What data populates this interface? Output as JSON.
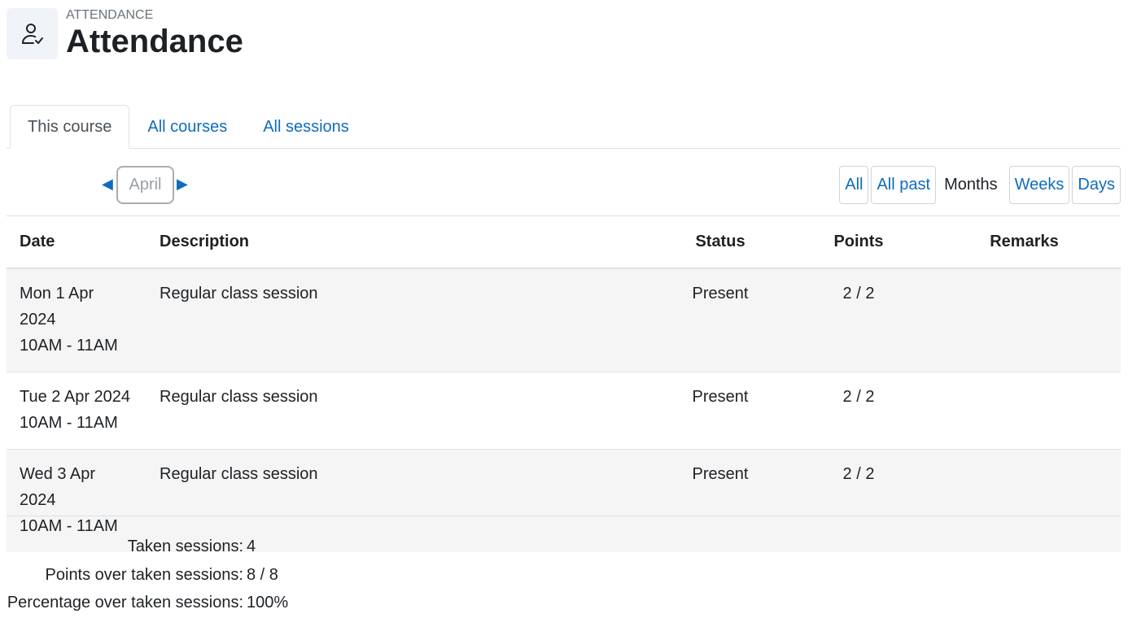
{
  "header": {
    "pretitle": "ATTENDANCE",
    "title": "Attendance",
    "icon": "user-check-icon"
  },
  "tabs": [
    {
      "label": "This course",
      "active": true
    },
    {
      "label": "All courses",
      "active": false
    },
    {
      "label": "All sessions",
      "active": false
    }
  ],
  "navigation": {
    "prev_icon": "◀",
    "next_icon": "▶",
    "current_month": "April"
  },
  "views": {
    "all": "All",
    "all_past": "All past",
    "months": "Months",
    "weeks": "Weeks",
    "days": "Days"
  },
  "table": {
    "columns": [
      "Date",
      "Description",
      "Status",
      "Points",
      "Remarks"
    ],
    "rows": [
      {
        "date": "Mon 1 Apr 2024",
        "time": "10AM - 11AM",
        "description": "Regular class session",
        "status": "Present",
        "points": "2 / 2",
        "remarks": ""
      },
      {
        "date": "Tue 2 Apr 2024",
        "time": "10AM - 11AM",
        "description": "Regular class session",
        "status": "Present",
        "points": "2 / 2",
        "remarks": ""
      },
      {
        "date": "Wed 3 Apr 2024",
        "time": "10AM - 11AM",
        "description": "Regular class session",
        "status": "Present",
        "points": "2 / 2",
        "remarks": ""
      }
    ]
  },
  "summary": [
    {
      "label": "Taken sessions:",
      "value": "4"
    },
    {
      "label": "Points over taken sessions:",
      "value": "8 / 8"
    },
    {
      "label": "Percentage over taken sessions:",
      "value": "100%"
    }
  ],
  "colors": {
    "link": "#0f6cbf",
    "text": "#1d2125",
    "row_bg": "#f5f5f5",
    "border": "#dee2e6"
  }
}
